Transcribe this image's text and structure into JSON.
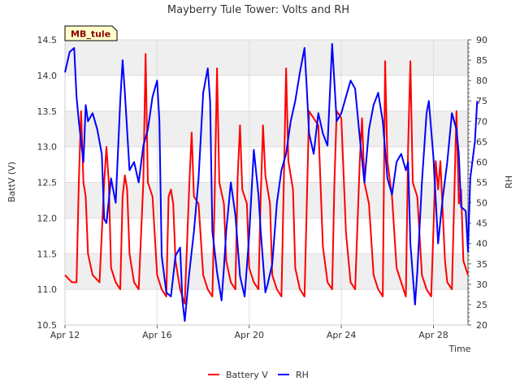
{
  "chart_data": {
    "type": "line",
    "title": "Mayberry Tule Tower: Volts and RH",
    "site_badge": "MB_tule",
    "xlabel": "Time",
    "ylabel_left": "BattV (V)",
    "ylabel_right": "RH",
    "x_ticks": [
      "Apr 12",
      "Apr 16",
      "Apr 20",
      "Apr 24",
      "Apr 28"
    ],
    "x_tick_days": [
      12,
      16,
      20,
      24,
      28
    ],
    "xlim_days": [
      12,
      29.5
    ],
    "ylim_left": [
      10.5,
      14.5
    ],
    "ylim_right": [
      20,
      90
    ],
    "y_ticks_left": [
      "10.5",
      "11.0",
      "11.5",
      "12.0",
      "12.5",
      "13.0",
      "13.5",
      "14.0",
      "14.5"
    ],
    "y_ticks_right": [
      "20",
      "25",
      "30",
      "35",
      "40",
      "45",
      "50",
      "55",
      "60",
      "65",
      "70",
      "75",
      "80",
      "85",
      "90"
    ],
    "grid": true,
    "legend_position": "bottom",
    "colors": {
      "battery": "#ff0000",
      "rh": "#0000ff",
      "band": "#efefef",
      "badge_bg": "#ffffcc"
    },
    "series": [
      {
        "name": "Battery V",
        "axis": "left",
        "points": [
          [
            12.0,
            11.2
          ],
          [
            12.3,
            11.1
          ],
          [
            12.5,
            11.1
          ],
          [
            12.6,
            12.5
          ],
          [
            12.7,
            13.5
          ],
          [
            12.8,
            12.5
          ],
          [
            12.9,
            12.3
          ],
          [
            13.0,
            11.5
          ],
          [
            13.2,
            11.2
          ],
          [
            13.5,
            11.1
          ],
          [
            13.7,
            12.5
          ],
          [
            13.8,
            13.0
          ],
          [
            13.9,
            12.5
          ],
          [
            14.0,
            11.3
          ],
          [
            14.2,
            11.1
          ],
          [
            14.4,
            11.0
          ],
          [
            14.5,
            12.3
          ],
          [
            14.6,
            12.6
          ],
          [
            14.7,
            12.4
          ],
          [
            14.8,
            11.5
          ],
          [
            15.0,
            11.1
          ],
          [
            15.2,
            11.0
          ],
          [
            15.4,
            12.5
          ],
          [
            15.5,
            14.3
          ],
          [
            15.6,
            12.5
          ],
          [
            15.8,
            12.3
          ],
          [
            16.0,
            11.2
          ],
          [
            16.2,
            11.0
          ],
          [
            16.4,
            10.9
          ],
          [
            16.5,
            12.3
          ],
          [
            16.6,
            12.4
          ],
          [
            16.7,
            12.2
          ],
          [
            16.8,
            11.4
          ],
          [
            17.0,
            11.0
          ],
          [
            17.2,
            10.8
          ],
          [
            17.4,
            12.5
          ],
          [
            17.5,
            13.2
          ],
          [
            17.6,
            12.3
          ],
          [
            17.8,
            12.2
          ],
          [
            18.0,
            11.2
          ],
          [
            18.2,
            11.0
          ],
          [
            18.4,
            10.9
          ],
          [
            18.5,
            12.3
          ],
          [
            18.6,
            14.1
          ],
          [
            18.7,
            12.5
          ],
          [
            18.9,
            12.2
          ],
          [
            19.0,
            11.4
          ],
          [
            19.2,
            11.1
          ],
          [
            19.4,
            11.0
          ],
          [
            19.5,
            12.6
          ],
          [
            19.6,
            13.3
          ],
          [
            19.7,
            12.4
          ],
          [
            19.9,
            12.2
          ],
          [
            20.0,
            11.3
          ],
          [
            20.2,
            11.1
          ],
          [
            20.4,
            11.0
          ],
          [
            20.5,
            12.3
          ],
          [
            20.6,
            13.3
          ],
          [
            20.7,
            12.6
          ],
          [
            20.9,
            12.2
          ],
          [
            21.0,
            11.2
          ],
          [
            21.2,
            11.0
          ],
          [
            21.4,
            10.9
          ],
          [
            21.5,
            12.5
          ],
          [
            21.6,
            14.1
          ],
          [
            21.7,
            12.8
          ],
          [
            21.9,
            12.4
          ],
          [
            22.0,
            11.3
          ],
          [
            22.2,
            11.0
          ],
          [
            22.4,
            10.9
          ],
          [
            22.5,
            12.2
          ],
          [
            22.6,
            13.5
          ],
          [
            22.8,
            13.4
          ],
          [
            23.0,
            13.3
          ],
          [
            23.2,
            11.6
          ],
          [
            23.4,
            11.1
          ],
          [
            23.6,
            11.0
          ],
          [
            23.7,
            12.5
          ],
          [
            23.8,
            13.5
          ],
          [
            24.0,
            13.4
          ],
          [
            24.2,
            11.8
          ],
          [
            24.4,
            11.1
          ],
          [
            24.6,
            11.0
          ],
          [
            24.8,
            12.8
          ],
          [
            24.9,
            13.4
          ],
          [
            25.0,
            12.5
          ],
          [
            25.2,
            12.2
          ],
          [
            25.4,
            11.2
          ],
          [
            25.6,
            11.0
          ],
          [
            25.8,
            10.9
          ],
          [
            25.9,
            14.2
          ],
          [
            26.0,
            12.8
          ],
          [
            26.2,
            12.3
          ],
          [
            26.4,
            11.3
          ],
          [
            26.6,
            11.1
          ],
          [
            26.8,
            10.9
          ],
          [
            26.9,
            13.0
          ],
          [
            27.0,
            14.2
          ],
          [
            27.1,
            12.5
          ],
          [
            27.3,
            12.3
          ],
          [
            27.5,
            11.2
          ],
          [
            27.7,
            11.0
          ],
          [
            27.9,
            10.9
          ],
          [
            28.1,
            12.8
          ],
          [
            28.2,
            12.4
          ],
          [
            28.3,
            12.8
          ],
          [
            28.5,
            11.4
          ],
          [
            28.6,
            11.1
          ],
          [
            28.8,
            11.0
          ],
          [
            29.0,
            13.5
          ],
          [
            29.1,
            12.2
          ],
          [
            29.2,
            12.4
          ],
          [
            29.3,
            11.4
          ],
          [
            29.5,
            11.2
          ]
        ]
      },
      {
        "name": "RH",
        "axis": "right",
        "points": [
          [
            12.0,
            82
          ],
          [
            12.2,
            87
          ],
          [
            12.4,
            88
          ],
          [
            12.5,
            76
          ],
          [
            12.6,
            70
          ],
          [
            12.8,
            60
          ],
          [
            12.9,
            74
          ],
          [
            13.0,
            70
          ],
          [
            13.2,
            72
          ],
          [
            13.4,
            68
          ],
          [
            13.6,
            62
          ],
          [
            13.7,
            46
          ],
          [
            13.8,
            45
          ],
          [
            14.0,
            56
          ],
          [
            14.2,
            50
          ],
          [
            14.4,
            75
          ],
          [
            14.5,
            85
          ],
          [
            14.6,
            77
          ],
          [
            14.8,
            58
          ],
          [
            15.0,
            60
          ],
          [
            15.2,
            55
          ],
          [
            15.4,
            64
          ],
          [
            15.6,
            68
          ],
          [
            15.8,
            76
          ],
          [
            16.0,
            80
          ],
          [
            16.1,
            70
          ],
          [
            16.2,
            37
          ],
          [
            16.4,
            28
          ],
          [
            16.6,
            27
          ],
          [
            16.8,
            37
          ],
          [
            17.0,
            39
          ],
          [
            17.1,
            26
          ],
          [
            17.2,
            21
          ],
          [
            17.4,
            33
          ],
          [
            17.6,
            43
          ],
          [
            17.8,
            56
          ],
          [
            18.0,
            77
          ],
          [
            18.2,
            83
          ],
          [
            18.3,
            75
          ],
          [
            18.4,
            43
          ],
          [
            18.6,
            33
          ],
          [
            18.8,
            26
          ],
          [
            18.9,
            34
          ],
          [
            19.0,
            43
          ],
          [
            19.2,
            55
          ],
          [
            19.4,
            47
          ],
          [
            19.6,
            32
          ],
          [
            19.8,
            27
          ],
          [
            20.0,
            42
          ],
          [
            20.2,
            63
          ],
          [
            20.4,
            52
          ],
          [
            20.5,
            43
          ],
          [
            20.7,
            28
          ],
          [
            20.8,
            30
          ],
          [
            21.0,
            35
          ],
          [
            21.2,
            50
          ],
          [
            21.4,
            58
          ],
          [
            21.6,
            62
          ],
          [
            21.8,
            70
          ],
          [
            22.0,
            75
          ],
          [
            22.2,
            82
          ],
          [
            22.4,
            88
          ],
          [
            22.5,
            78
          ],
          [
            22.6,
            67
          ],
          [
            22.8,
            62
          ],
          [
            23.0,
            72
          ],
          [
            23.2,
            67
          ],
          [
            23.4,
            64
          ],
          [
            23.6,
            89
          ],
          [
            23.8,
            70
          ],
          [
            24.0,
            72
          ],
          [
            24.2,
            76
          ],
          [
            24.4,
            80
          ],
          [
            24.6,
            78
          ],
          [
            24.8,
            66
          ],
          [
            25.0,
            55
          ],
          [
            25.2,
            68
          ],
          [
            25.4,
            74
          ],
          [
            25.6,
            77
          ],
          [
            25.8,
            70
          ],
          [
            26.0,
            56
          ],
          [
            26.2,
            52
          ],
          [
            26.4,
            60
          ],
          [
            26.6,
            62
          ],
          [
            26.8,
            58
          ],
          [
            26.9,
            60
          ],
          [
            27.0,
            40
          ],
          [
            27.2,
            25
          ],
          [
            27.3,
            33
          ],
          [
            27.5,
            55
          ],
          [
            27.7,
            72
          ],
          [
            27.8,
            75
          ],
          [
            28.0,
            61
          ],
          [
            28.2,
            40
          ],
          [
            28.4,
            51
          ],
          [
            28.6,
            60
          ],
          [
            28.8,
            72
          ],
          [
            29.0,
            68
          ],
          [
            29.1,
            62
          ],
          [
            29.2,
            49
          ],
          [
            29.4,
            48
          ],
          [
            29.5,
            38
          ],
          [
            29.6,
            56
          ],
          [
            29.8,
            65
          ],
          [
            29.9,
            75
          ]
        ]
      }
    ]
  }
}
